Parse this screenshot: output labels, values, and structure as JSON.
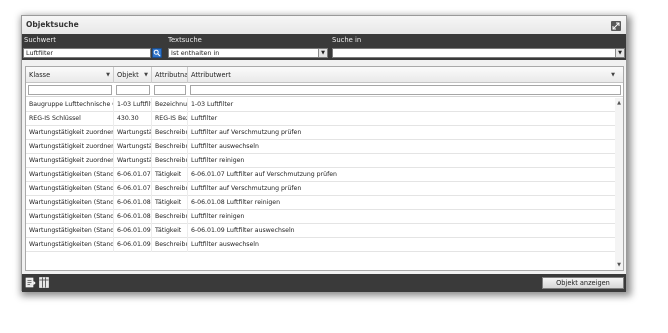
{
  "window": {
    "title": "Objektsuche"
  },
  "search": {
    "suchwert_label": "Suchwert",
    "suchwert_value": "Luftfilter",
    "textsuche_label": "Textsuche",
    "textsuche_value": "Ist enthalten in",
    "suche_in_label": "Suche in",
    "suche_in_value": ""
  },
  "grid": {
    "columns": [
      {
        "label": "Klasse"
      },
      {
        "label": "Objekt"
      },
      {
        "label": "Attributna"
      },
      {
        "label": "Attributwert"
      }
    ],
    "rows": [
      [
        "Baugruppe Lufttechnische Ger",
        "1-03 Luftfilt",
        "Bezeichnur",
        "1-03 Luftfilter"
      ],
      [
        "REG-IS Schlüssel",
        "430.30",
        "REG-IS Bez",
        "Luftfilter"
      ],
      [
        "Wartungstätigkeit zuordnen (S",
        "Wartungstä",
        "Beschreibu",
        "Luftfilter auf Verschmutzung prüfen"
      ],
      [
        "Wartungstätigkeit zuordnen (S",
        "Wartungstä",
        "Beschreibu",
        "Luftfilter auswechseln"
      ],
      [
        "Wartungstätigkeit zuordnen (S",
        "Wartungstä",
        "Beschreibu",
        "Luftfilter reinigen"
      ],
      [
        "Wartungstätigkeiten (Standar",
        "6-06.01.07",
        "Tätigkeit",
        "6-06.01.07 Luftfilter auf Verschmutzung prüfen"
      ],
      [
        "Wartungstätigkeiten (Standar",
        "6-06.01.07",
        "Beschreibu",
        "Luftfilter auf Verschmutzung prüfen"
      ],
      [
        "Wartungstätigkeiten (Standar",
        "6-06.01.08",
        "Tätigkeit",
        "6-06.01.08 Luftfilter reinigen"
      ],
      [
        "Wartungstätigkeiten (Standar",
        "6-06.01.08",
        "Beschreibu",
        "Luftfilter reinigen"
      ],
      [
        "Wartungstätigkeiten (Standar",
        "6-06.01.09",
        "Tätigkeit",
        "6-06.01.09 Luftfilter auswechseln"
      ],
      [
        "Wartungstätigkeiten (Standar",
        "6-06.01.09",
        "Beschreibu",
        "Luftfilter auswechseln"
      ]
    ]
  },
  "footer": {
    "show_object_label": "Objekt anzeigen"
  },
  "colors": {
    "dark_bar": "#3a3a3a",
    "search_button": "#2e73c9"
  },
  "icons": {
    "resize": "expand-icon",
    "search": "search-icon",
    "export": "export-icon",
    "columns": "columns-icon"
  }
}
